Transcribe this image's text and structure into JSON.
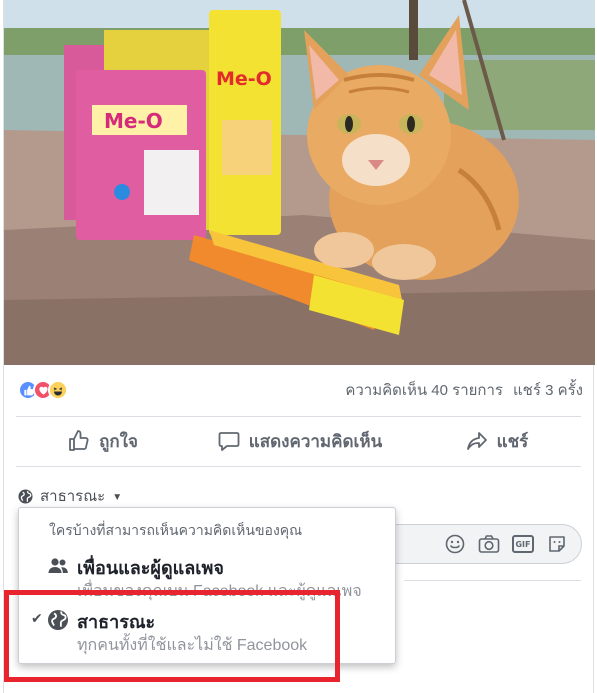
{
  "post": {
    "reactions": [
      {
        "type": "like",
        "icon": "thumbs-up-icon",
        "color": "#5890ff"
      },
      {
        "type": "love",
        "icon": "heart-icon",
        "color": "#f25268"
      },
      {
        "type": "haha",
        "icon": "laugh-icon",
        "color": "#fcd15b"
      }
    ],
    "comments_count_text": "ความคิดเห็น 40 รายการ",
    "shares_count_text": "แชร์ 3 ครั้ง"
  },
  "actions": {
    "like_label": "ถูกใจ",
    "comment_label": "แสดงความคิดเห็น",
    "share_label": "แชร์"
  },
  "audience_selector": {
    "label": "สาธารณะ",
    "icon": "globe-icon"
  },
  "audience_menu": {
    "title": "ใครบ้างที่สามารถเห็นความคิดเห็นของคุณ",
    "options": [
      {
        "name": "เพื่อนและผู้ดูแลเพจ",
        "description": "เพื่อนของคุณบน Facebook และผู้ดูแลเพจ",
        "icon": "friends-icon",
        "selected": false
      },
      {
        "name": "สาธารณะ",
        "description": "ทุกคนทั้งที่ใช้และไม่ใช้ Facebook",
        "icon": "globe-icon",
        "selected": true
      }
    ]
  },
  "composer": {
    "icons": [
      "emoji-icon",
      "camera-icon",
      "gif-icon",
      "sticker-icon"
    ],
    "gif_label": "GIF"
  },
  "photo": {
    "brand_text": "Me-O",
    "subject": "orange tabby kitten"
  },
  "colors": {
    "highlight": "#e8252e",
    "like": "#5890ff",
    "text_secondary": "#606770"
  }
}
